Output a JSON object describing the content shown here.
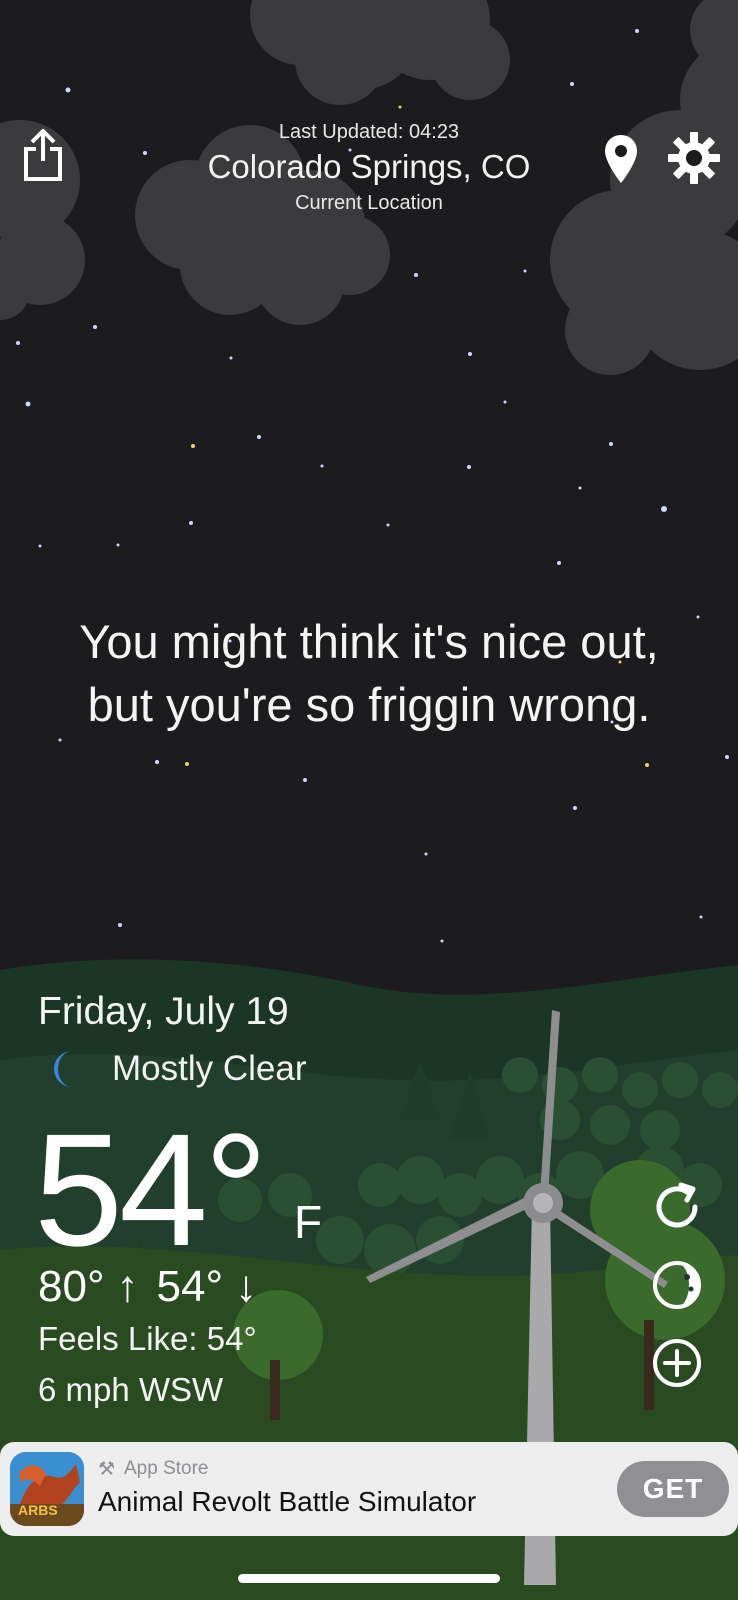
{
  "header": {
    "last_updated": "Last Updated: 04:23",
    "city": "Colorado Springs, CO",
    "location_label": "Current Location"
  },
  "message": {
    "line1": "You might think it's nice out,",
    "line2": "but you're so friggin wrong."
  },
  "weather": {
    "date": "Friday, July 19",
    "condition": "Mostly Clear",
    "condition_icon": "moon-icon",
    "temperature": "54°",
    "unit": "F",
    "high": "80°",
    "low": "54°",
    "feels_like": "Feels Like: 54°",
    "wind": "6 mph WSW"
  },
  "icons": {
    "share": "share-icon",
    "location": "location-pin-icon",
    "settings": "gear-icon",
    "refresh": "refresh-icon",
    "moon_phase": "moon-phase-icon",
    "add": "add-circle-icon"
  },
  "ad": {
    "store_label": "App Store",
    "title": "Animal Revolt Battle Simulator",
    "cta": "GET",
    "icon_text": "ARBS"
  },
  "colors": {
    "sky": "#1c1c1e",
    "hill_dark": "#1c3a2a",
    "grass": "#2a4a22",
    "cloud": "#3d3d3f",
    "ad_bg": "#ededee",
    "get_button": "#8f8f94"
  }
}
